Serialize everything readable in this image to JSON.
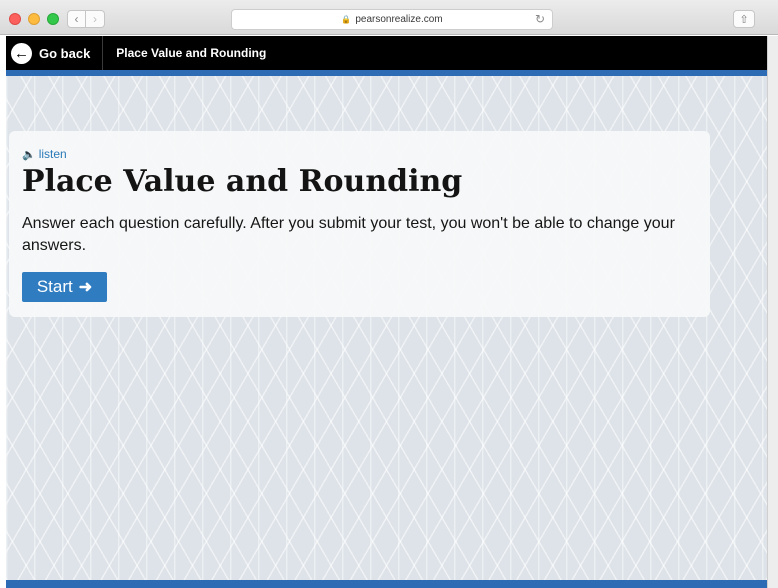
{
  "browser": {
    "url": "pearsonrealize.com",
    "icons": {
      "back": "chevron-left-icon",
      "forward": "chevron-right-icon",
      "lock": "lock-icon",
      "reload": "reload-icon",
      "share": "share-icon"
    }
  },
  "header": {
    "back_label": "Go back",
    "title": "Place Value and Rounding",
    "accent_color": "#2e6bb5"
  },
  "card": {
    "listen_label": "listen",
    "title": "Place Value and Rounding",
    "description": "Answer each question carefully. After you submit your test, you won't be able to change your answers.",
    "start_label": "Start",
    "start_color": "#2f7cc1"
  }
}
